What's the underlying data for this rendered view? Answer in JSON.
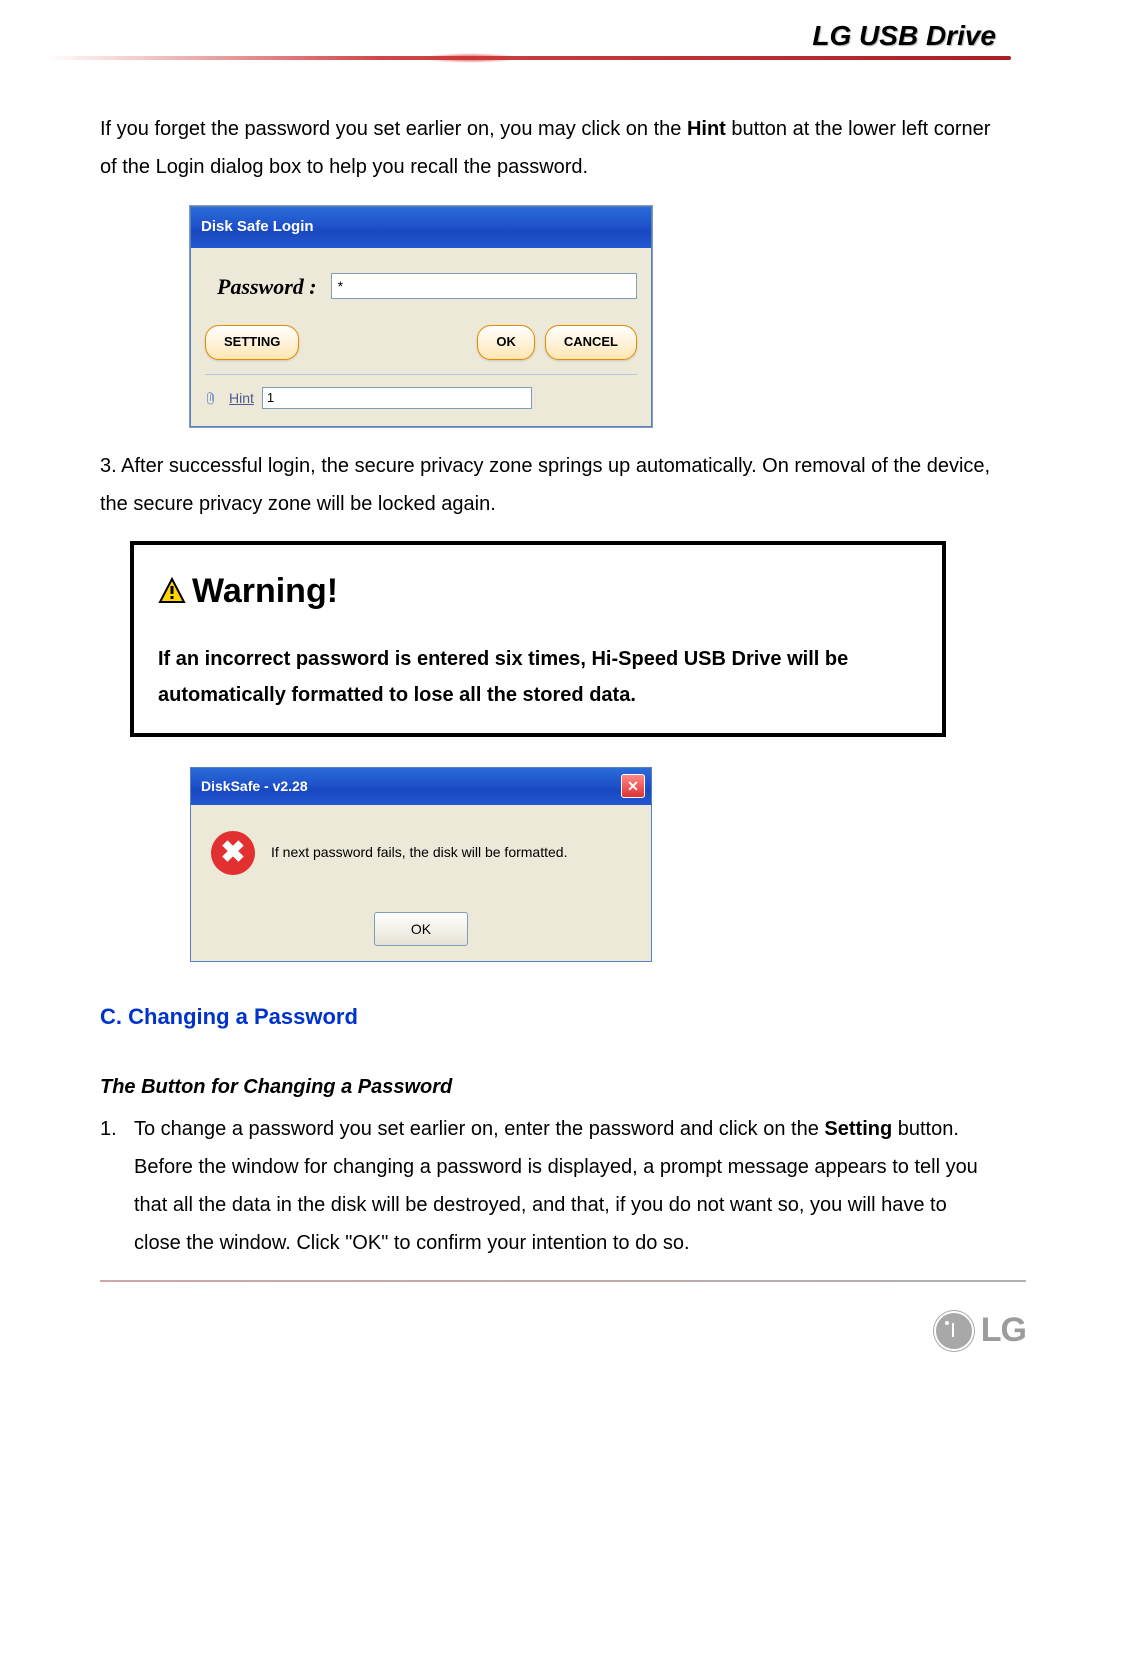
{
  "header": {
    "title": "LG USB Drive"
  },
  "intro": {
    "text_a": "If you forget the password you set earlier on, you may click on the ",
    "hint_word": "Hint",
    "text_b": " button at the lower left corner of the Login dialog box to help you recall the password."
  },
  "login_dialog": {
    "title": "Disk Safe Login",
    "password_label": "Password :",
    "password_value": "*",
    "setting_btn": "SETTING",
    "ok_btn": "OK",
    "cancel_btn": "CANCEL",
    "hint_link": "Hint",
    "hint_value": "1"
  },
  "step3": "3. After successful login, the secure privacy zone springs up automatically. On removal of the device, the secure privacy zone will be locked again.",
  "warning": {
    "title": "Warning!",
    "text": "If an incorrect password is entered six times, Hi-Speed USB Drive will be automatically formatted to lose all the stored data."
  },
  "msg_dialog": {
    "title": "DiskSafe - v2.28",
    "message": "If next password fails, the disk will be formatted.",
    "ok_btn": "OK"
  },
  "section_c": {
    "heading": "C. Changing a Password",
    "subheading": "The Button for Changing a Password",
    "item1_num": "1.",
    "item1_a": "To change a password you set earlier on, enter the password and click on the ",
    "item1_bold": "Setting",
    "item1_b": " button. Before the window for changing a password is displayed, a prompt message appears to tell you that all the data in the disk will be destroyed, and that, if you do not want so, you will have to close the window. Click \"OK\" to confirm your intention to do so."
  },
  "logo": {
    "text": "LG"
  }
}
